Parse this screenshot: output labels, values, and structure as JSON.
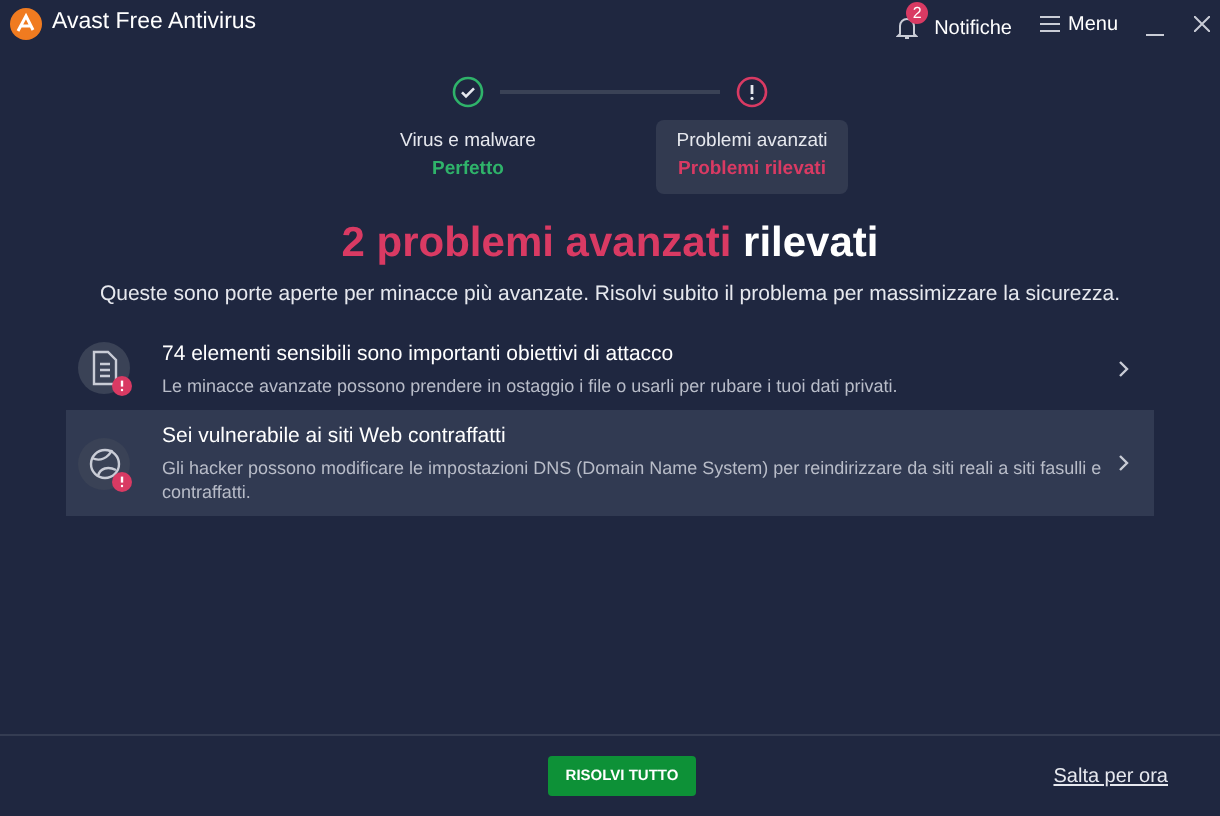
{
  "window": {
    "title": "Avast Free Antivirus",
    "notifications": {
      "label": "Notifiche",
      "count": "2"
    },
    "menu": "Menu"
  },
  "steps": [
    {
      "kind": "ok",
      "label": "Virus e malware",
      "status": "Perfetto",
      "selected": false
    },
    {
      "kind": "alert",
      "label": "Problemi avanzati",
      "status": "Problemi rilevati",
      "selected": true
    }
  ],
  "heading": {
    "highlight": "2 problemi avanzati",
    "rest": "rilevati"
  },
  "subtitle": "Queste sono porte aperte per minacce più avanzate. Risolvi subito il problema per massimizzare la sicurezza.",
  "issues": [
    {
      "kind": "document",
      "title": "74 elementi sensibili sono importanti obiettivi di attacco",
      "description": "Le minacce avanzate possono prendere in ostaggio i file o usarli per rubare i tuoi dati privati.",
      "selected": false
    },
    {
      "kind": "globe",
      "title": "Sei vulnerabile ai siti Web contraffatti",
      "description": "Gli hacker possono modificare le impostazioni DNS (Domain Name System) per reindirizzare da siti reali a siti fasulli e contraffatti.",
      "selected": true
    }
  ],
  "footer": {
    "primary": "RISOLVI TUTTO",
    "link": "Salta per ora"
  }
}
